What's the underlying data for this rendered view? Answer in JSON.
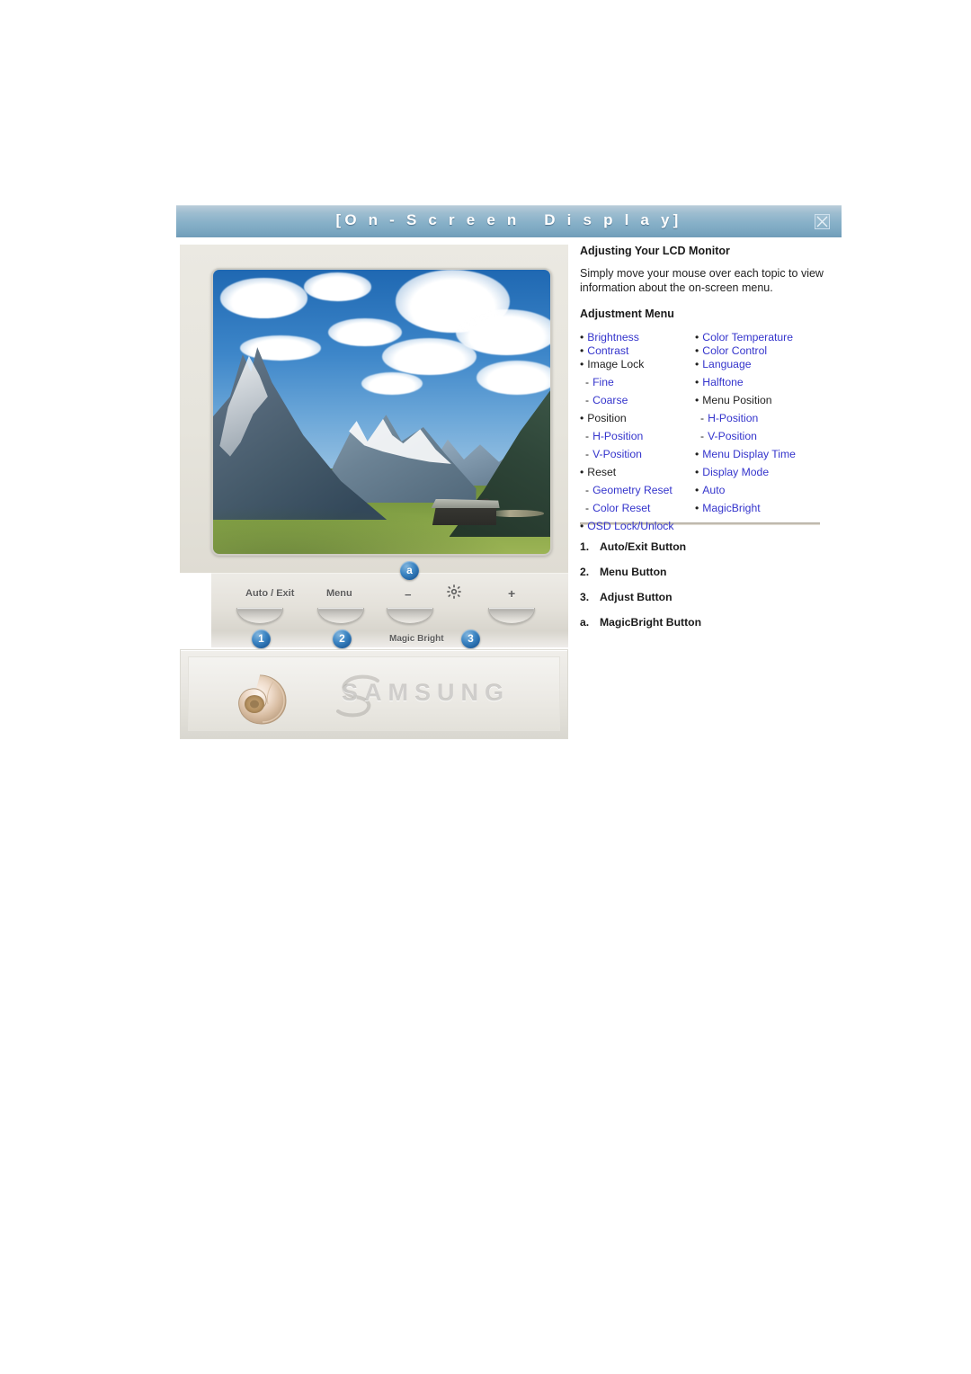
{
  "window": {
    "title": "[O n - S c r e e n   D i s p l a y]",
    "close_icon": "close-icon"
  },
  "info": {
    "heading": "Adjusting Your LCD Monitor",
    "intro": "Simply move your mouse over each topic to view information about the on-screen menu.",
    "menu_heading": "Adjustment Menu"
  },
  "adjustment_menu": {
    "left_column": [
      {
        "marker": "•",
        "label": "Brightness",
        "link": true,
        "level": 1,
        "spacing": "tight"
      },
      {
        "marker": "•",
        "label": "Contrast",
        "link": true,
        "level": 1,
        "spacing": "tight"
      },
      {
        "marker": "•",
        "label": "Image Lock",
        "link": false,
        "level": 1,
        "spacing": "tight"
      },
      {
        "marker": "-",
        "label": "Fine",
        "link": true,
        "level": 2,
        "spacing": "loose"
      },
      {
        "marker": "-",
        "label": "Coarse",
        "link": true,
        "level": 2,
        "spacing": "loose"
      },
      {
        "marker": "•",
        "label": "Position",
        "link": false,
        "level": 1,
        "spacing": "loose"
      },
      {
        "marker": "-",
        "label": "H-Position",
        "link": true,
        "level": 2,
        "spacing": "loose"
      },
      {
        "marker": "-",
        "label": "V-Position",
        "link": true,
        "level": 2,
        "spacing": "loose"
      },
      {
        "marker": "•",
        "label": "Reset",
        "link": false,
        "level": 1,
        "spacing": "loose"
      },
      {
        "marker": "-",
        "label": "Geometry Reset",
        "link": true,
        "level": 2,
        "spacing": "loose"
      },
      {
        "marker": "-",
        "label": "Color Reset",
        "link": true,
        "level": 2,
        "spacing": "loose"
      },
      {
        "marker": "•",
        "label": "OSD Lock/Unlock",
        "link": true,
        "level": 1,
        "spacing": "loose"
      }
    ],
    "right_column": [
      {
        "marker": "•",
        "label": "Color Temperature",
        "link": true,
        "level": 1,
        "spacing": "tight"
      },
      {
        "marker": "•",
        "label": "Color Control",
        "link": true,
        "level": 1,
        "spacing": "tight"
      },
      {
        "marker": "•",
        "label": "Language",
        "link": true,
        "level": 1,
        "spacing": "tight"
      },
      {
        "marker": "•",
        "label": "Halftone",
        "link": true,
        "level": 1,
        "spacing": "loose"
      },
      {
        "marker": "•",
        "label": "Menu Position",
        "link": false,
        "level": 1,
        "spacing": "loose"
      },
      {
        "marker": "-",
        "label": "H-Position",
        "link": true,
        "level": 2,
        "spacing": "loose"
      },
      {
        "marker": "-",
        "label": "V-Position",
        "link": true,
        "level": 2,
        "spacing": "loose"
      },
      {
        "marker": "•",
        "label": "Menu Display Time",
        "link": true,
        "level": 1,
        "spacing": "loose"
      },
      {
        "marker": "•",
        "label": "Display Mode",
        "link": true,
        "level": 1,
        "spacing": "loose"
      },
      {
        "marker": "•",
        "label": "Auto",
        "link": true,
        "level": 1,
        "spacing": "loose"
      },
      {
        "marker": "•",
        "label": "MagicBright",
        "link": true,
        "level": 1,
        "spacing": "loose"
      }
    ]
  },
  "button_legend": [
    {
      "num": "1.",
      "label": "Auto/Exit Button"
    },
    {
      "num": "2.",
      "label": "Menu Button"
    },
    {
      "num": "3.",
      "label": "Adjust Button"
    },
    {
      "num": "a.",
      "label": "MagicBright Button"
    }
  ],
  "monitor": {
    "screen_image": "mountain-landscape-photo",
    "controls": [
      {
        "label": "Auto / Exit",
        "badge": "1"
      },
      {
        "label": "Menu",
        "badge": "2"
      },
      {
        "label": "−",
        "badge": "a"
      },
      {
        "label": "gear-icon",
        "badge": ""
      },
      {
        "label": "+",
        "badge": "3"
      }
    ],
    "magicbright_caption": "Magic Bright",
    "brand": "SAMSUNG"
  },
  "colors": {
    "titlebar_top": "#b9ccd9",
    "titlebar_bottom": "#6f9cb8",
    "titlebar_rule": "#2f4f6b",
    "link_blue": "#3434cc",
    "body_text": "#1f1f1f",
    "badge_blue": "#1f5f9e",
    "bezel": "#e6e4dc"
  }
}
